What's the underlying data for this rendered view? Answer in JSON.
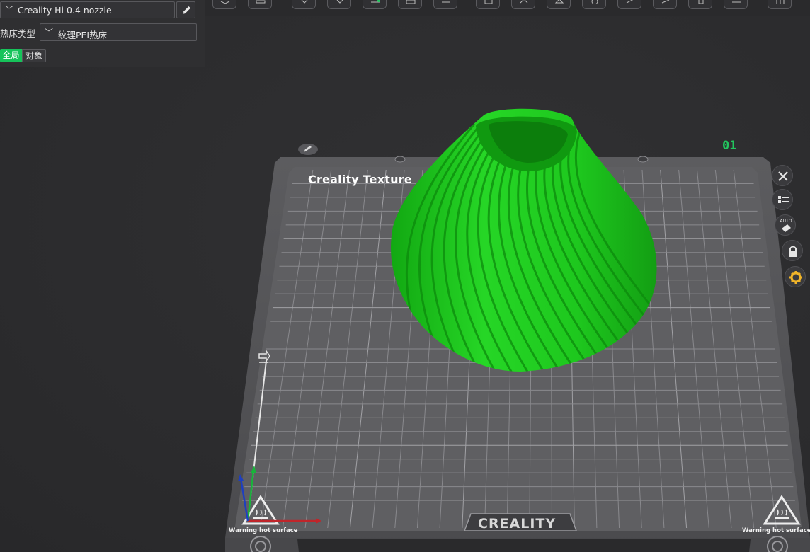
{
  "left_panel": {
    "printer": "Creality Hi 0.4 nozzle",
    "bed_type_label": "热床类型",
    "bed_type_value": "纹理PEI热床",
    "tabs": {
      "global": "全局",
      "object": "对象"
    }
  },
  "bed": {
    "plate_label": "Creality Texture",
    "plate_number": "01",
    "brand": "CREALITY",
    "warning_left": "Warning hot surface",
    "warning_right": "Warning hot surface"
  },
  "side_controls": {
    "auto_label": "AUTO"
  },
  "colors": {
    "model": "#22c422",
    "accent": "#16c35a",
    "plate_number": "#22c55e"
  },
  "icons": [
    "chevron-down-icon",
    "pencil-icon",
    "close-icon",
    "list-icon",
    "auto-arrange-icon",
    "lock-icon",
    "gear-icon",
    "edit-plate-icon"
  ]
}
